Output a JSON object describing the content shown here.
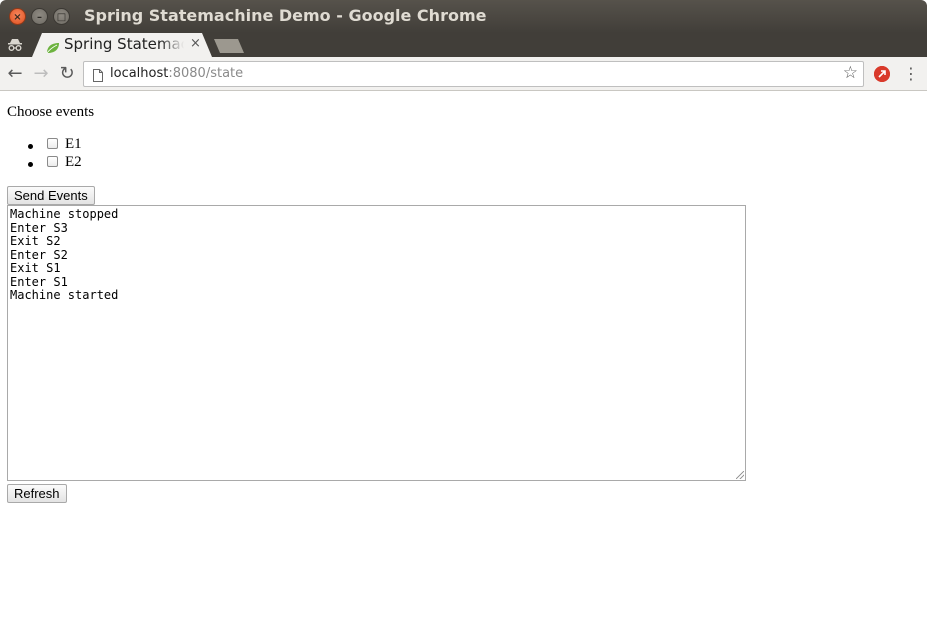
{
  "window": {
    "title": "Spring Statemachine Demo - Google Chrome",
    "close_glyph": "×",
    "min_glyph": "–",
    "max_glyph": "□"
  },
  "tab": {
    "title": "Spring Statemachine Demo",
    "close_glyph": "×",
    "favicon": "spring-leaf-icon"
  },
  "toolbar": {
    "back_glyph": "←",
    "forward_glyph": "→",
    "reload_glyph": "↻",
    "url_host": "localhost",
    "url_rest": ":8080/state",
    "star_glyph": "☆",
    "menu_glyph": "⋮"
  },
  "page": {
    "heading": "Choose events",
    "events": [
      {
        "label": "E1",
        "checked": false
      },
      {
        "label": "E2",
        "checked": false
      }
    ],
    "send_button": "Send Events",
    "refresh_button": "Refresh",
    "log_lines": [
      "Machine stopped",
      "Enter S3",
      "Exit S2",
      "Enter S2",
      "Exit S1",
      "Enter S1",
      "Machine started"
    ]
  },
  "colors": {
    "titlebar": "#4a4741",
    "close_button": "#e95420",
    "tab_bg": "#f2f1ef",
    "spring_green": "#6db33f"
  }
}
